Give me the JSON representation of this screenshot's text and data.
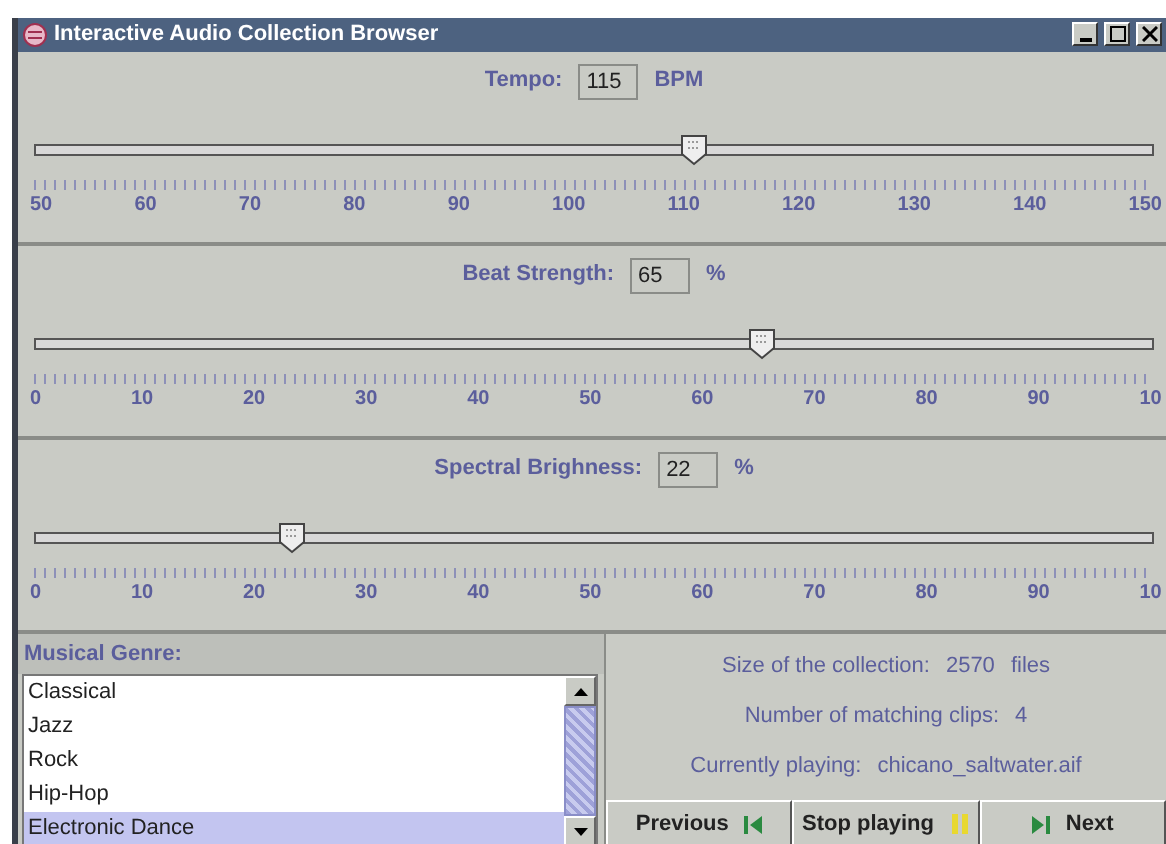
{
  "window": {
    "title": "Interactive Audio Collection Browser"
  },
  "sliders": [
    {
      "label": "Tempo:",
      "value": "115",
      "unit": "BPM",
      "level": 0.59,
      "ticks": [
        "50",
        "60",
        "70",
        "80",
        "90",
        "100",
        "110",
        "120",
        "130",
        "140",
        "150"
      ]
    },
    {
      "label": "Beat Strength:",
      "value": "65",
      "unit": "%",
      "level": 0.65,
      "ticks": [
        "0",
        "10",
        "20",
        "30",
        "40",
        "50",
        "60",
        "70",
        "80",
        "90",
        "10"
      ]
    },
    {
      "label": "Spectral Brighness:",
      "value": "22",
      "unit": "%",
      "level": 0.23,
      "ticks": [
        "0",
        "10",
        "20",
        "30",
        "40",
        "50",
        "60",
        "70",
        "80",
        "90",
        "10"
      ]
    }
  ],
  "genre": {
    "heading": "Musical Genre:",
    "items": [
      {
        "label": "Classical",
        "selected": false
      },
      {
        "label": "Jazz",
        "selected": false
      },
      {
        "label": "Rock",
        "selected": false
      },
      {
        "label": "Hip-Hop",
        "selected": false
      },
      {
        "label": "Electronic Dance",
        "selected": true
      }
    ]
  },
  "info": [
    {
      "label": "Size of the collection:",
      "value": "2570",
      "unit": "files"
    },
    {
      "label": "Number of matching clips:",
      "value": "4"
    },
    {
      "label": "Currently playing:",
      "value": "chicano_saltwater.aif"
    }
  ],
  "buttons": [
    {
      "label": "Previous",
      "kind": "previous"
    },
    {
      "label": "Stop playing",
      "kind": "pause"
    },
    {
      "label": "Next",
      "kind": "next"
    }
  ]
}
